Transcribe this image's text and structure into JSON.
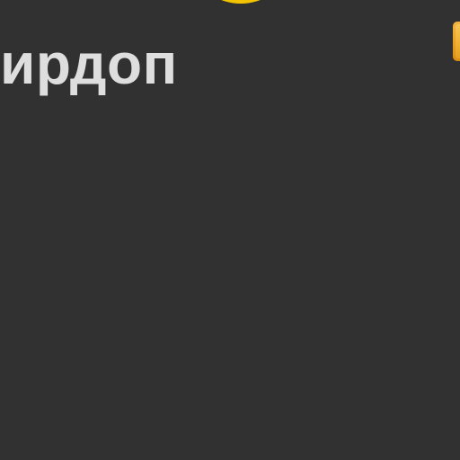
{
  "header": {
    "title": "ирдоп"
  },
  "colors": {
    "background": "#313131",
    "title_text": "#dedede",
    "accent_ring": "#f2c400",
    "accent_button": "#e8a020"
  },
  "icons": {
    "logo": "circle-logo-icon"
  }
}
